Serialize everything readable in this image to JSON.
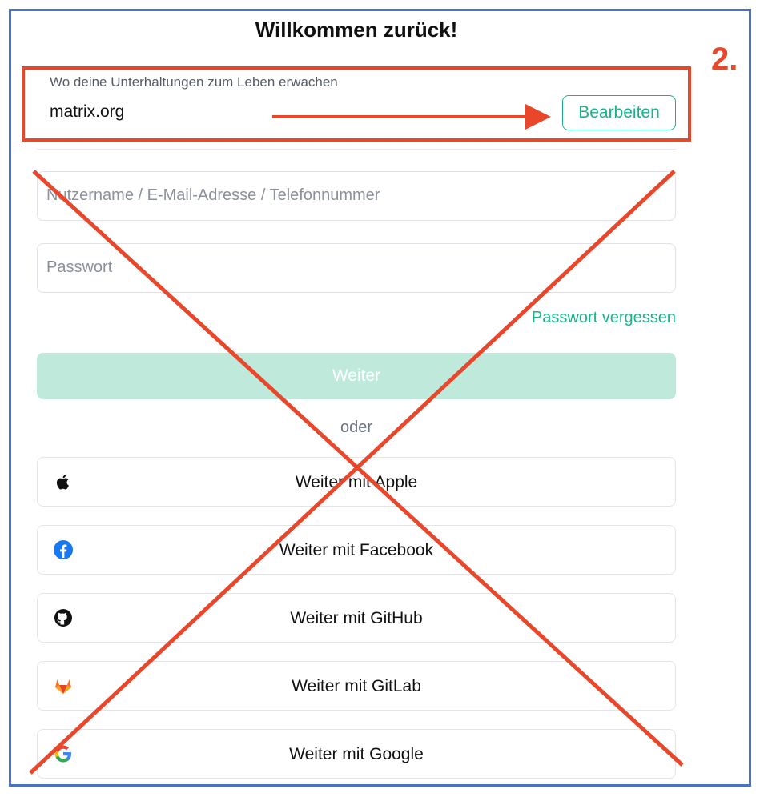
{
  "title": "Willkommen zurück!",
  "step_marker": "2.",
  "server": {
    "subtitle": "Wo deine Unterhaltungen zum Leben erwachen",
    "name": "matrix.org",
    "edit_label": "Bearbeiten"
  },
  "form": {
    "username_placeholder": "Nutzername / E-Mail-Adresse / Telefonnummer",
    "password_placeholder": "Passwort",
    "forgot_label": "Passwort vergessen",
    "continue_label": "Weiter",
    "or_label": "oder"
  },
  "sso": [
    {
      "label": "Weiter mit Apple",
      "icon": "apple-icon"
    },
    {
      "label": "Weiter mit Facebook",
      "icon": "facebook-icon"
    },
    {
      "label": "Weiter mit GitHub",
      "icon": "github-icon"
    },
    {
      "label": "Weiter mit GitLab",
      "icon": "gitlab-icon"
    },
    {
      "label": "Weiter mit Google",
      "icon": "google-icon"
    }
  ],
  "colors": {
    "accent": "#18b38a",
    "annotation": "#e8472c",
    "frame": "#4a72c4"
  }
}
